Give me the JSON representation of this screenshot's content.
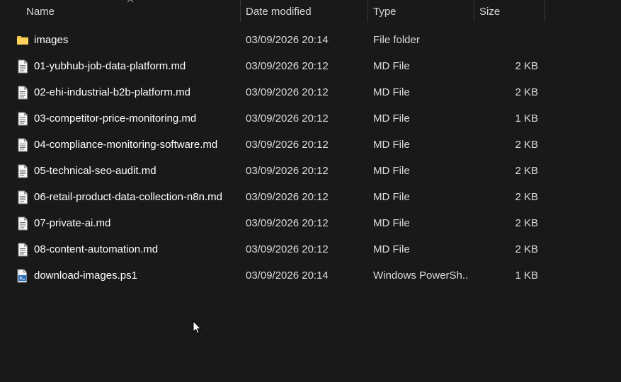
{
  "columns": {
    "name": "Name",
    "date": "Date modified",
    "type": "Type",
    "size": "Size"
  },
  "files": [
    {
      "name": "images",
      "date": "03/09/2026 20:14",
      "type": "File folder",
      "size": "",
      "icon": "folder-icon"
    },
    {
      "name": "01-yubhub-job-data-platform.md",
      "date": "03/09/2026 20:12",
      "type": "MD File",
      "size": "2 KB",
      "icon": "document-icon"
    },
    {
      "name": "02-ehi-industrial-b2b-platform.md",
      "date": "03/09/2026 20:12",
      "type": "MD File",
      "size": "2 KB",
      "icon": "document-icon"
    },
    {
      "name": "03-competitor-price-monitoring.md",
      "date": "03/09/2026 20:12",
      "type": "MD File",
      "size": "1 KB",
      "icon": "document-icon"
    },
    {
      "name": "04-compliance-monitoring-software.md",
      "date": "03/09/2026 20:12",
      "type": "MD File",
      "size": "2 KB",
      "icon": "document-icon"
    },
    {
      "name": "05-technical-seo-audit.md",
      "date": "03/09/2026 20:12",
      "type": "MD File",
      "size": "2 KB",
      "icon": "document-icon"
    },
    {
      "name": "06-retail-product-data-collection-n8n.md",
      "date": "03/09/2026 20:12",
      "type": "MD File",
      "size": "2 KB",
      "icon": "document-icon"
    },
    {
      "name": "07-private-ai.md",
      "date": "03/09/2026 20:12",
      "type": "MD File",
      "size": "2 KB",
      "icon": "document-icon"
    },
    {
      "name": "08-content-automation.md",
      "date": "03/09/2026 20:12",
      "type": "MD File",
      "size": "2 KB",
      "icon": "document-icon"
    },
    {
      "name": "download-images.ps1",
      "date": "03/09/2026 20:14",
      "type": "Windows PowerSh...",
      "size": "1 KB",
      "icon": "powershell-script-icon"
    }
  ],
  "colors": {
    "background": "#191919",
    "folder": "#f2c14b",
    "text": "#ffffff"
  }
}
